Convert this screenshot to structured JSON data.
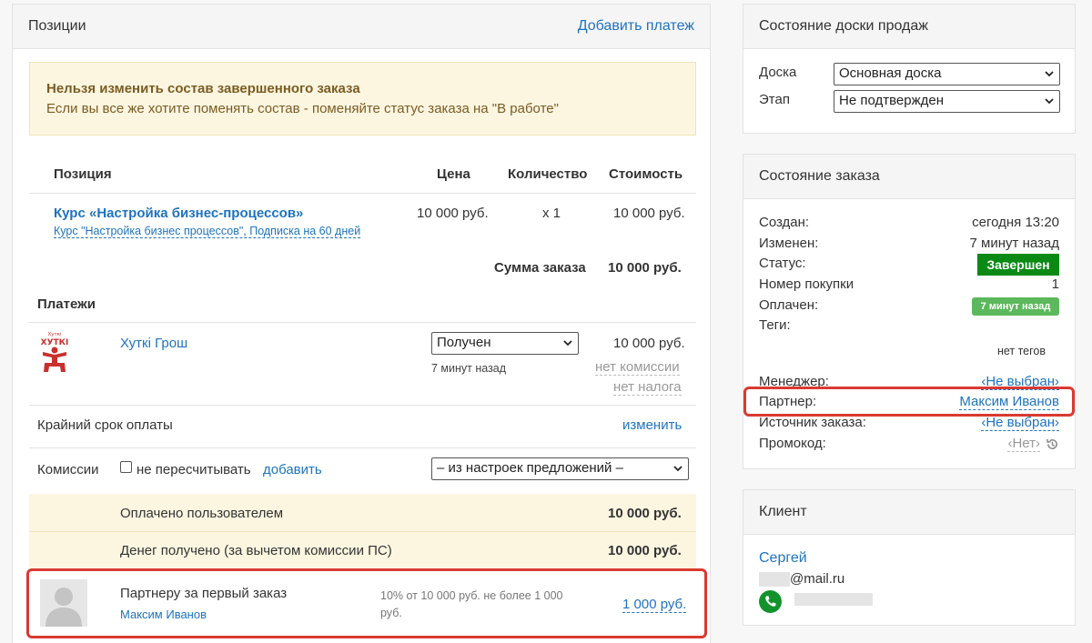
{
  "positions_panel": {
    "title": "Позиции",
    "add_payment_label": "Добавить платеж",
    "warning": {
      "title": "Нельзя изменить состав завершенного заказа",
      "text": "Если вы все же хотите поменять состав - поменяйте статус заказа на \"В работе\""
    },
    "columns": {
      "position": "Позиция",
      "price": "Цена",
      "quantity": "Количество",
      "cost": "Стоимость"
    },
    "item": {
      "name": "Курс «Настройка бизнес-процессов»",
      "subtitle": "Курс \"Настройка бизнес процессов\", Подписка на 60 дней",
      "price": "10 000 руб.",
      "quantity": "x 1",
      "cost": "10 000 руб."
    },
    "order_sum_label": "Сумма заказа",
    "order_sum_value": "10 000 руб.",
    "payments_title": "Платежи",
    "payment": {
      "logo_text_top": "Хуткі",
      "logo_text": "ХУТКІ",
      "provider": "Хуткi Грош",
      "status_selected": "Получен",
      "time": "7 минут назад",
      "amount": "10 000 руб.",
      "commission_link": "нет комиссии",
      "tax_link": "нет налога"
    },
    "deadline_label": "Крайний срок оплаты",
    "deadline_change": "изменить",
    "commissions_label": "Комиссии",
    "no_recalc_label": "не пересчитывать",
    "add_label": "добавить",
    "commission_select": "– из настроек предложений –",
    "paid_by_user_label": "Оплачено пользователем",
    "paid_by_user_value": "10 000 руб.",
    "received_label": "Денег получено (за вычетом комиссии ПС)",
    "received_value": "10 000 руб.",
    "partner_row": {
      "title": "Партнеру за первый заказ",
      "name": "Максим Иванов",
      "formula": "10% от 10 000 руб. не более 1 000 руб.",
      "amount": "1 000 руб."
    }
  },
  "board_panel": {
    "title": "Состояние доски продаж",
    "board_label": "Доска",
    "board_value": "Основная доска",
    "stage_label": "Этап",
    "stage_value": "Не подтвержден"
  },
  "order_panel": {
    "title": "Состояние заказа",
    "created_label": "Создан:",
    "created_value": "сегодня 13:20",
    "changed_label": "Изменен:",
    "changed_value": "7 минут назад",
    "status_label": "Статус:",
    "status_value": "Завершен",
    "purchase_no_label": "Номер покупки",
    "purchase_no_value": "1",
    "paid_label": "Оплачен:",
    "paid_value": "7 минут назад",
    "tags_label": "Теги:",
    "tags_value": "нет тегов",
    "manager_label": "Менеджер:",
    "manager_value": "‹Не выбран›",
    "partner_label": "Партнер:",
    "partner_value": "Максим Иванов",
    "source_label": "Источник заказа:",
    "source_value": "‹Не выбран›",
    "promo_label": "Промокод:",
    "promo_value": "‹Нет›"
  },
  "client_panel": {
    "title": "Клиент",
    "name": "Сергей",
    "email_suffix": "@mail.ru"
  },
  "colors": {
    "link": "#1e73be",
    "status_green": "#0a8a14",
    "paid_green": "#5cb85c",
    "warning_bg": "#fcf6e1",
    "highlight_red": "#d93a31",
    "logo_red": "#c9302c",
    "phone_green": "#12922b"
  }
}
